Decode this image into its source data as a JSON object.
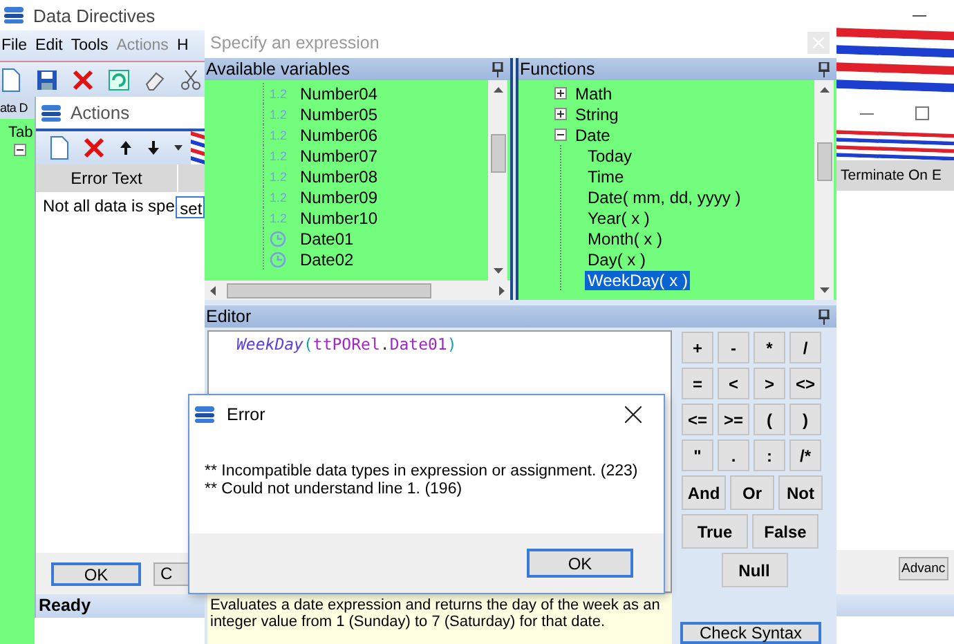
{
  "main_window": {
    "title": "Data Directives",
    "menu": [
      {
        "label": "File",
        "disabled": false
      },
      {
        "label": "Edit",
        "disabled": false
      },
      {
        "label": "Tools",
        "disabled": false
      },
      {
        "label": "Actions",
        "disabled": true
      },
      {
        "label": "H",
        "disabled": false
      }
    ],
    "tab": "ata D",
    "tree_item": "Tab"
  },
  "back_window": {
    "column": "Terminate On E",
    "button": "Advanc"
  },
  "actions_window": {
    "title": "Actions",
    "columns": [
      "Error Text"
    ],
    "rows": [
      {
        "cells": [
          "Not all data is spe",
          "set"
        ]
      }
    ],
    "buttons": [
      "OK",
      "C"
    ],
    "status": "Ready"
  },
  "expression_dialog": {
    "title": "Specify an expression",
    "variables": {
      "title": "Available variables",
      "items": [
        {
          "kind": "number",
          "badge": "1.2",
          "label": "Number04"
        },
        {
          "kind": "number",
          "badge": "1.2",
          "label": "Number05"
        },
        {
          "kind": "number",
          "badge": "1.2",
          "label": "Number06"
        },
        {
          "kind": "number",
          "badge": "1.2",
          "label": "Number07"
        },
        {
          "kind": "number",
          "badge": "1.2",
          "label": "Number08"
        },
        {
          "kind": "number",
          "badge": "1.2",
          "label": "Number09"
        },
        {
          "kind": "number",
          "badge": "1.2",
          "label": "Number10"
        },
        {
          "kind": "date",
          "label": "Date01"
        },
        {
          "kind": "date",
          "label": "Date02"
        }
      ]
    },
    "functions": {
      "title": "Functions",
      "items": [
        {
          "label": "Math",
          "expanded": false,
          "selected": false
        },
        {
          "label": "String",
          "expanded": false,
          "selected": false
        },
        {
          "label": "Date",
          "expanded": true,
          "selected": false,
          "children": [
            {
              "label": "Today",
              "selected": false
            },
            {
              "label": "Time",
              "selected": false
            },
            {
              "label": "Date( mm, dd, yyyy )",
              "selected": false
            },
            {
              "label": "Year( x )",
              "selected": false
            },
            {
              "label": "Month( x )",
              "selected": false
            },
            {
              "label": "Day( x )",
              "selected": false
            },
            {
              "label": "WeekDay( x )",
              "selected": true
            }
          ]
        }
      ]
    },
    "editor": {
      "title": "Editor",
      "tokens": [
        {
          "kind": "function",
          "text": "WeekDay"
        },
        {
          "kind": "paren",
          "text": "("
        },
        {
          "kind": "identifier",
          "text": "ttPORel"
        },
        {
          "kind": "dot",
          "text": "."
        },
        {
          "kind": "identifier",
          "text": "Date01"
        },
        {
          "kind": "paren",
          "text": ")"
        }
      ]
    },
    "operators": [
      [
        "+",
        "-",
        "*",
        "/"
      ],
      [
        "=",
        "<",
        ">",
        "<>"
      ],
      [
        "<=",
        ">=",
        "(",
        ")"
      ],
      [
        "\"",
        ".",
        ":",
        "/*"
      ],
      [
        "And",
        "Or",
        "Not"
      ],
      [
        "True",
        "False"
      ],
      [
        "Null"
      ]
    ],
    "description": "Evaluates a date expression and returns the day of the week as an integer value from 1 (Sunday) to 7 (Saturday) for that date.",
    "check_button": "Check Syntax"
  },
  "error_dialog": {
    "title": "Error",
    "lines": [
      "** Incompatible data types in expression or assignment. (223)",
      "** Could not understand line 1. (196)"
    ],
    "button": "OK"
  }
}
